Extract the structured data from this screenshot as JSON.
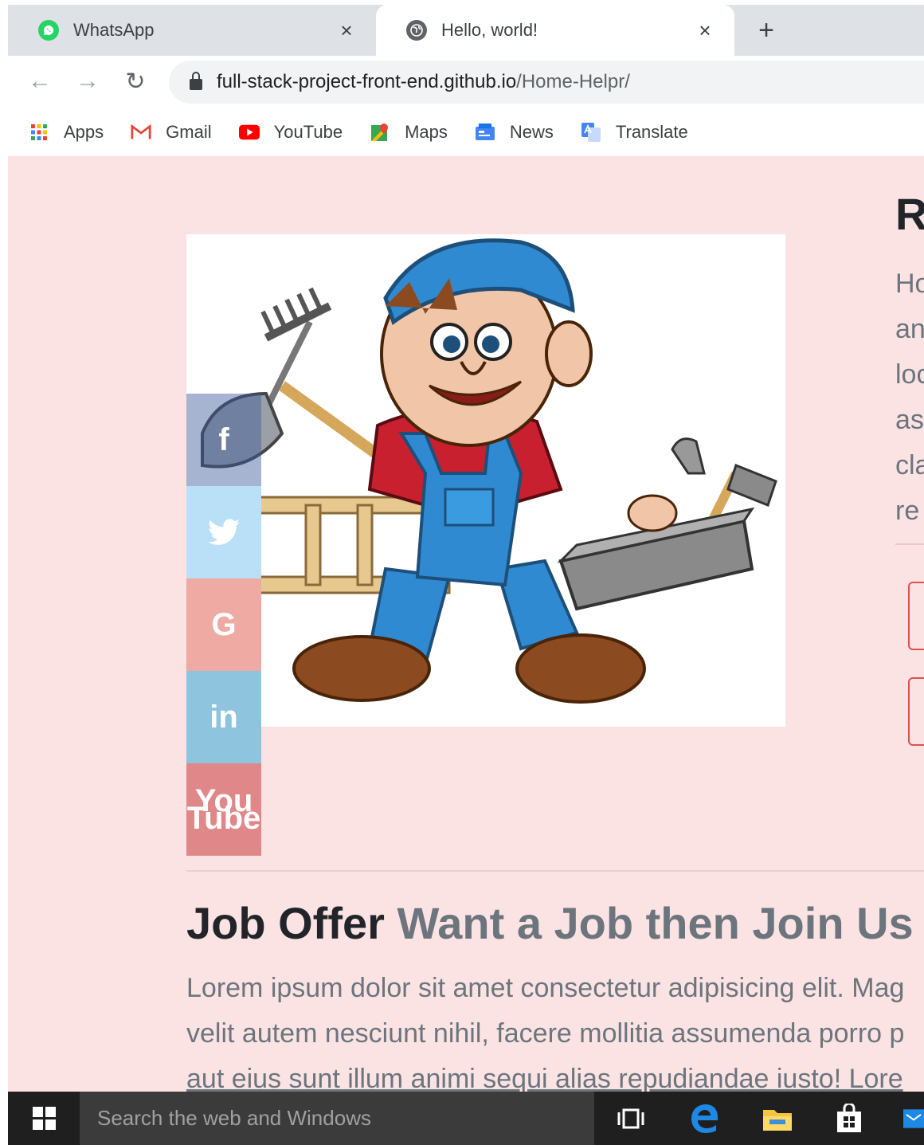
{
  "browser": {
    "tabs": [
      {
        "title": "WhatsApp",
        "active": false
      },
      {
        "title": "Hello, world!",
        "active": true
      }
    ],
    "close_glyph": "×",
    "new_tab_glyph": "+",
    "url_host": "full-stack-project-front-end.github.io",
    "url_path": "/Home-Helpr/",
    "bookmarks": [
      "Apps",
      "Gmail",
      "YouTube",
      "Maps",
      "News",
      "Translate"
    ]
  },
  "content": {
    "right_title": "R",
    "right_lines": [
      "Ho",
      "an",
      "loc",
      "as",
      "cla",
      "re"
    ],
    "social_icons": [
      "facebook-icon",
      "twitter-icon",
      "google-icon",
      "linkedin-icon",
      "youtube-icon"
    ],
    "social_glyphs": {
      "facebook": "f",
      "google": "G",
      "linkedin": "in",
      "youtube_top": "You",
      "youtube_bottom": "Tube"
    },
    "job_title_main": "Job Offer",
    "job_title_sub": "Want a Job then Join Us",
    "lorem_lines": [
      "Lorem ipsum dolor sit amet consectetur adipisicing elit. Mag",
      "velit autem nesciunt nihil, facere mollitia assumenda porro p",
      "aut eius sunt illum animi sequi alias repudiandae iusto! Lore"
    ]
  },
  "taskbar": {
    "search_placeholder": "Search the web and Windows"
  },
  "colors": {
    "page_bg": "#fbe3e4",
    "heading": "#212529",
    "muted": "#6c757d",
    "button_border": "#d9534f"
  }
}
